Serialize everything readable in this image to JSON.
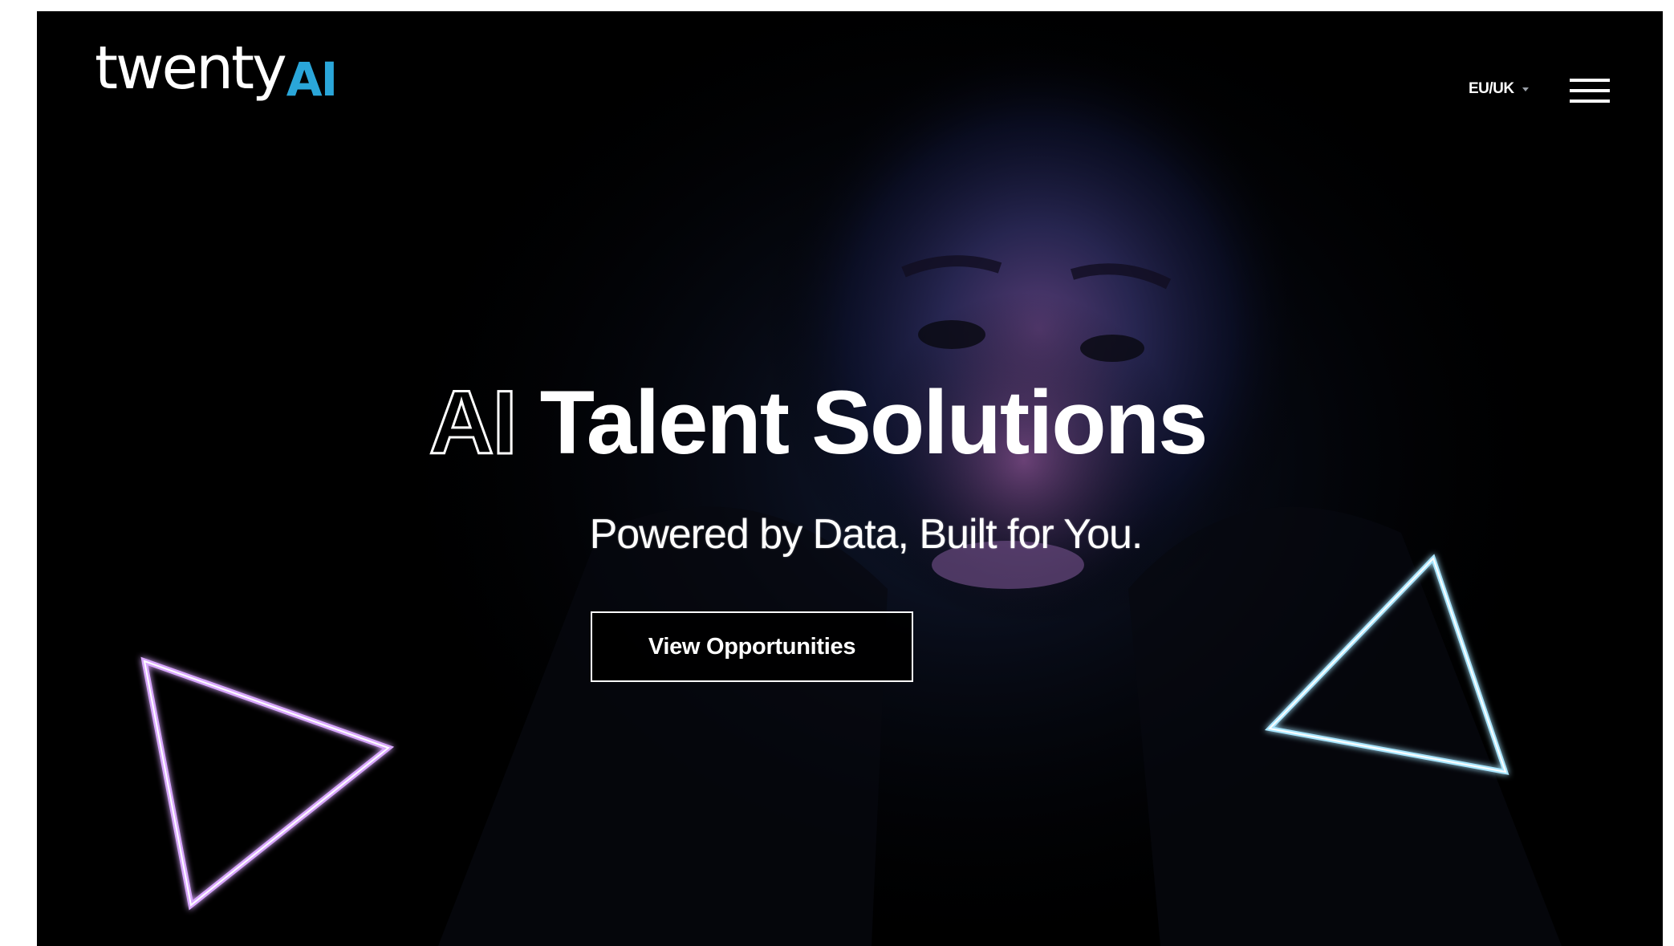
{
  "header": {
    "logo_word": "twenty",
    "logo_suffix": "AI",
    "region_label": "EU/UK",
    "menu_icon": "hamburger-menu-icon"
  },
  "hero": {
    "headline_outline": "AI",
    "headline_solid": "Talent Solutions",
    "subheadline": "Powered by Data, Built for You.",
    "cta_label": "View Opportunities"
  },
  "colors": {
    "background": "#000000",
    "logo_accent": "#2aa6d9",
    "triangle_left": "#d9a8ff",
    "triangle_right": "#a9e6ff",
    "text": "#ffffff"
  },
  "decorations": {
    "left_shape": "neon-triangle-icon",
    "right_shape": "neon-triangle-icon"
  }
}
